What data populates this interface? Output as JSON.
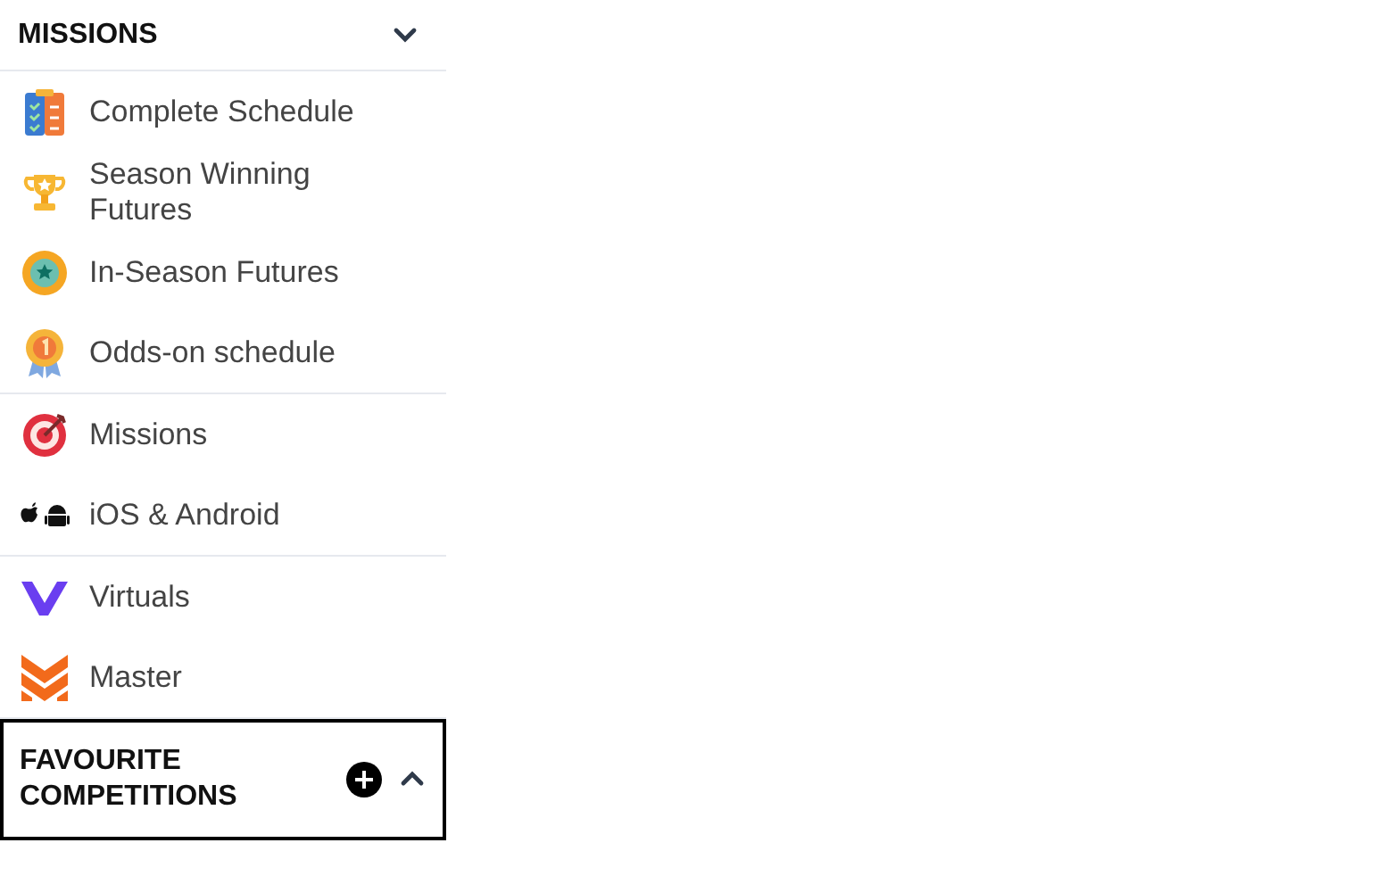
{
  "header": {
    "title": "MISSIONS",
    "expanded": true
  },
  "groups": [
    {
      "items": [
        {
          "label": "Complete Schedule"
        },
        {
          "label": "Season Winning Futures"
        },
        {
          "label": "In-Season Futures"
        },
        {
          "label": "Odds-on schedule"
        }
      ]
    },
    {
      "items": [
        {
          "label": "Missions"
        },
        {
          "label": "iOS & Android"
        }
      ]
    },
    {
      "items": [
        {
          "label": "Virtuals"
        },
        {
          "label": "Master"
        }
      ]
    }
  ],
  "favourites": {
    "title": "FAVOURITE COMPETITIONS",
    "expanded": false,
    "focused": true
  }
}
